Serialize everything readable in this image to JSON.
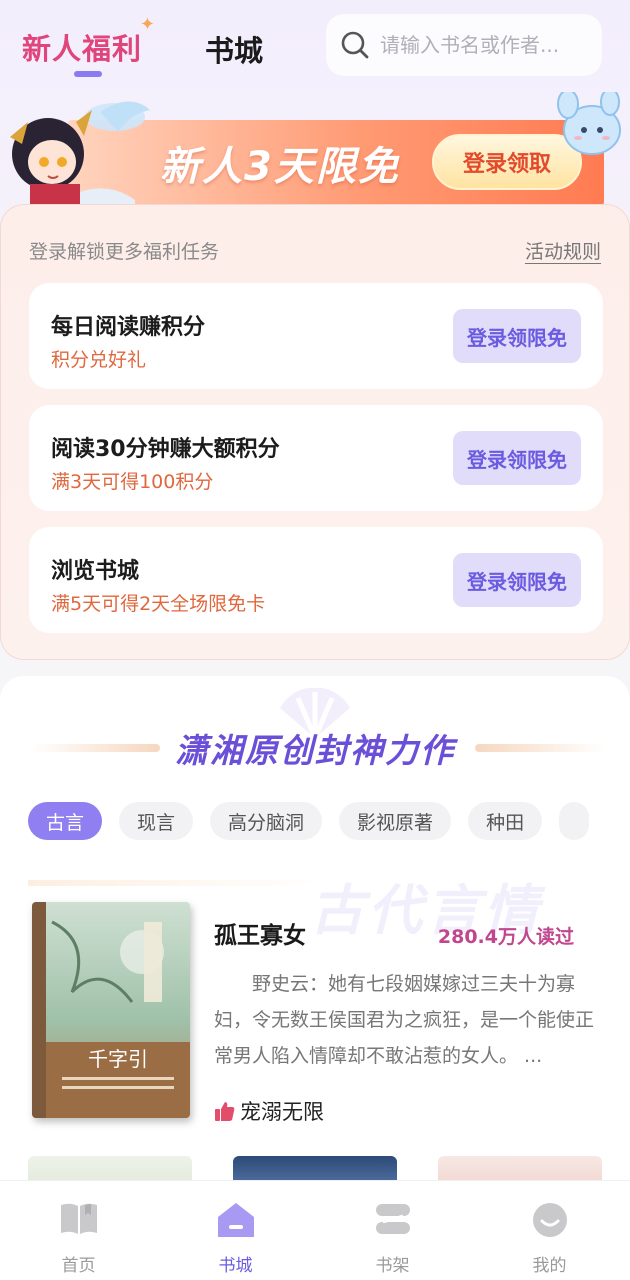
{
  "header": {
    "tab_welfare": "新人福利",
    "tab_bookcity": "书城",
    "search_placeholder": "请输入书名或作者..."
  },
  "banner": {
    "text": "新人3天限免",
    "button": "登录领取"
  },
  "tasks": {
    "hint": "登录解锁更多福利任务",
    "rules": "活动规则",
    "items": [
      {
        "title": "每日阅读赚积分",
        "subtitle": "积分兑好礼",
        "button": "登录领限免"
      },
      {
        "title": "阅读30分钟赚大额积分",
        "subtitle": "满3天可得100积分",
        "button": "登录领限免"
      },
      {
        "title": "浏览书城",
        "subtitle": "满5天可得2天全场限免卡",
        "button": "登录领限免"
      }
    ]
  },
  "recommend": {
    "title": "潇湘原创封神力作",
    "chips": [
      "古言",
      "现言",
      "高分脑洞",
      "影视原著",
      "种田"
    ],
    "active_chip": "古言",
    "genre_watermark": "古代言情",
    "book": {
      "name": "孤王寡女",
      "reads": "280.4万人读过",
      "description": "野史云：她有七段姻媒嫁过三夫十为寡妇，令无数王侯国君为之疯狂，是一个能使正常男人陷入情障却不敢沾惹的女人。 ...",
      "tag": "宠溺无限",
      "cover_title": "千字引"
    }
  },
  "bottom_nav": {
    "items": [
      {
        "label": "首页",
        "icon": "book-open-icon"
      },
      {
        "label": "书城",
        "icon": "house-icon"
      },
      {
        "label": "书架",
        "icon": "shelf-icon"
      },
      {
        "label": "我的",
        "icon": "smile-face-icon"
      }
    ],
    "active": "书城"
  },
  "colors": {
    "accent": "#8f7ff0",
    "welfare_pink": "#e0457b",
    "task_orange": "#e0683e",
    "reads_magenta": "#c0468e"
  }
}
